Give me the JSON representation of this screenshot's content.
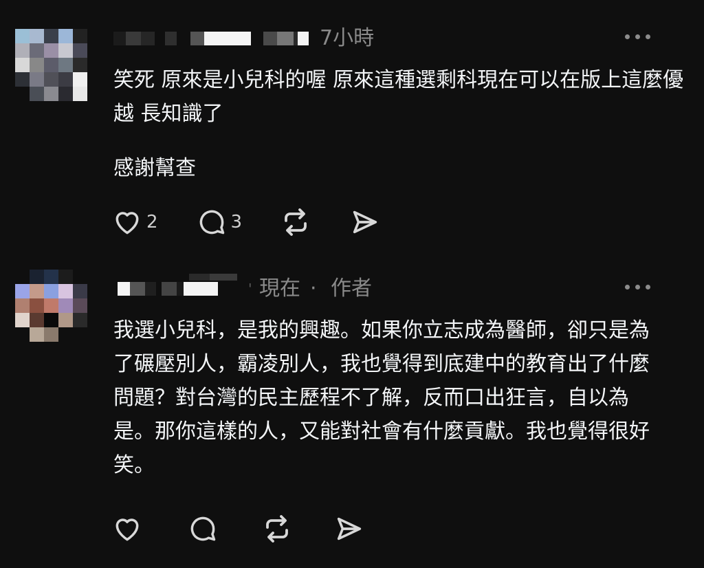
{
  "posts": [
    {
      "time": "7小時",
      "paragraphs": [
        "笑死 原來是小兒科的喔 原來這種選剩科現在可以在版上這麼優越 長知識了",
        "感謝幫查"
      ],
      "likes": "2",
      "replies": "3",
      "avatar_colors": [
        "#9bbfd6",
        "#a8b9d0",
        "#3a3f4a",
        "#9cb7d8",
        "#222222",
        "#b0b0b8",
        "#6b6b78",
        "#9a8fa6",
        "#c8c8d0",
        "#4a4a58",
        "#d8d8d8",
        "#888888",
        "#5c5c6a",
        "#6e7882",
        "#2a2a2a",
        "#2d3036",
        "#7a7a86",
        "#505058",
        "#3c3c44",
        "#f0f0f0",
        "#0f0f0f",
        "#4a4e56",
        "#8a8a90",
        "#2a2a30",
        "#e8e8e8"
      ]
    },
    {
      "time": "現在",
      "separator": "·",
      "author_tag": "作者",
      "paragraphs": [
        "我選小兒科，是我的興趣。如果你立志成為醫師，卻只是為了碾壓別人，霸凌別人，我也覺得到底建中的教育出了什麼問題？對台灣的民主歷程不了解，反而口出狂言，自以為是。那你這樣的人，又能對社會有什麼貢獻。我也覺得很好笑。"
      ],
      "avatar_colors": [
        "#0f0f0f",
        "#1a2230",
        "#23324a",
        "#1c1c1c",
        "#0f0f0f",
        "#9aa4e8",
        "#c49a8a",
        "#8aa0e0",
        "#d8c4e0",
        "#3a3a48",
        "#b08070",
        "#8a5040",
        "#c07a6a",
        "#a08ab8",
        "#5a4a58",
        "#e0d4cc",
        "#5a3a30",
        "#0a0a0a",
        "#b09888",
        "#2a2a2a",
        "#0f0f0f",
        "#b8a898",
        "#8a7a6c",
        "#0f0f0f",
        "#0f0f0f"
      ]
    }
  ],
  "icons": [
    "heart-icon",
    "comment-icon",
    "repost-icon",
    "share-icon",
    "more-icon"
  ]
}
